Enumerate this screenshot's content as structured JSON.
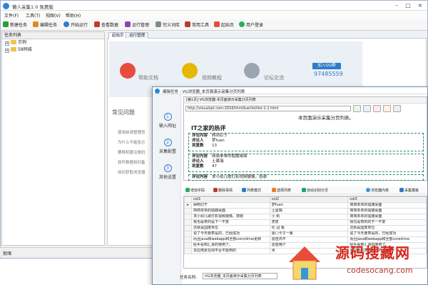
{
  "app": {
    "title": "懒人采集1.0 免费版"
  },
  "menu": [
    "文件(F)",
    "工具(T)",
    "视图(V)",
    "帮助(H)"
  ],
  "toolbar": [
    "新建任务",
    "编辑任务",
    "开始运行",
    "查看数据",
    "运行管理",
    "完义词库",
    "常用工具",
    "起始页",
    "用户登录"
  ],
  "sidebar": {
    "header": "任务列表",
    "items": [
      "示例",
      "58同城"
    ]
  },
  "tabs": [
    "起始页",
    "运行管理"
  ],
  "banner": {
    "items": [
      "帮助文档",
      "视频教程",
      "论坛交流"
    ],
    "qq_button": "加入QQ群",
    "qq_number": "97485559"
  },
  "faq": {
    "title": "常见问题",
    "items": [
      "使用前请管理员",
      "为什么不能显示",
      "要换机器注册码",
      "软件数据如何备",
      "如何获取浏览器"
    ]
  },
  "status": "就绪",
  "dialog": {
    "title": "编辑任务 - VG浏览器_本页面演示采集分页列表",
    "steps": [
      {
        "n": "1",
        "label": "输入网址"
      },
      {
        "n": "2",
        "label": "采集配置"
      },
      {
        "n": "3",
        "label": "其他设置"
      }
    ],
    "browser_title": "[第1页] VG浏览器-本页面演示采集分页列表",
    "url": "http://visualspt.com-2016/html/kanlist/list-1-1.html",
    "page_heading": "本页面演示采集分页列表。",
    "site_title": "IT之家的热评",
    "records": [
      {
        "content": "碍到幻于",
        "author": "梦fuan",
        "count": "13"
      },
      {
        "content": "简简单单的骷髅桌面",
        "author": "土葛瑞",
        "count": "47"
      },
      {
        "content": "求小幼儿歌灯影视频摄像。感谢"
      }
    ],
    "field_labels": {
      "content": "评论内容",
      "author": "评论人",
      "count": "到复数"
    },
    "grid_toolbar": [
      "增加字段",
      "删除事情",
      "列表模式",
      "选择列表",
      "自动识别分页",
      "浏览器内核",
      "采集模板"
    ],
    "columns": [
      "col1",
      "col2",
      "col3"
    ],
    "rows": [
      [
        "碍到幻于",
        "梦fuan",
        "简简单单的骷髅桌面"
      ],
      [
        "简简单单的骷髅桌面",
        "土葛瑞",
        "简简单单的骷髅桌面"
      ],
      [
        "求小幼儿歌灯影视频摄像。感谢",
        "小 帆",
        "简简单单的骷髅桌面"
      ],
      [
        "我也是奇的是下一不复",
        "虎皮",
        "我也是奇的的于一不复"
      ],
      [
        "还就是国度单位",
        "化 冠 髦",
        "还就是国度单位"
      ],
      [
        "说了今天要表是的，已经成功",
        "猜门卡子一量",
        "说了今天要表是的，已经成功"
      ],
      [
        "而且java和webapp和全部com/drive更新",
        "雷连鸿平",
        "而且java和webapp和全部coredrive"
      ],
      [
        "经手看到汇录的使用了。",
        "雷首用户",
        "经手看到汇录的使用了。"
      ],
      [
        "本应用走在线平台不能用的",
        "米",
        "本应用走在线平台不能用的"
      ]
    ],
    "task_name_label": "任务名称:",
    "task_name": "VG浏览器_本页面演示采集分页列表"
  },
  "watermark": {
    "cn": "源码搜藏网",
    "en": "codesocang.com"
  },
  "colors": {
    "accent": "#2e7cc7",
    "watermark": "#d6281d"
  }
}
